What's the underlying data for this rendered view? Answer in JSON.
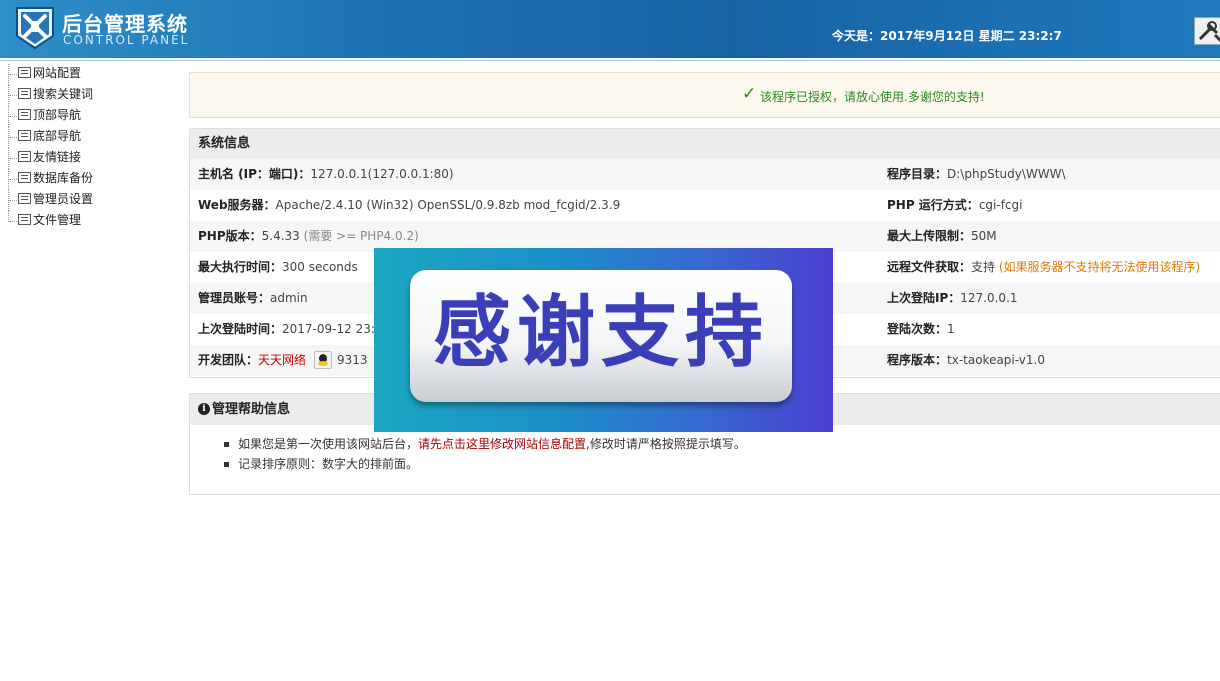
{
  "header": {
    "title": "后台管理系统",
    "subtitle": "CONTROL PANEL",
    "today": "今天是：2017年9月12日 星期二 23:2:7",
    "tools_icon": "tools-icon"
  },
  "sidebar": {
    "items": [
      {
        "label": "网站配置"
      },
      {
        "label": "搜索关键词"
      },
      {
        "label": "顶部导航"
      },
      {
        "label": "底部导航"
      },
      {
        "label": "友情链接"
      },
      {
        "label": "数据库备份"
      },
      {
        "label": "管理员设置"
      },
      {
        "label": "文件管理"
      }
    ]
  },
  "notice": {
    "text": "该程序已授权，请放心使用.多谢您的支持!",
    "icon": "check-icon",
    "color": "#2a8a1f"
  },
  "system_info": {
    "title": "系统信息",
    "rows": [
      {
        "l_label": "主机名 (IP：端口)：",
        "l_value": "127.0.0.1(127.0.0.1:80)",
        "r_label": "程序目录：",
        "r_value": "D:\\phpStudy\\WWW\\"
      },
      {
        "l_label": "Web服务器：",
        "l_value": "Apache/2.4.10 (Win32) OpenSSL/0.9.8zb mod_fcgid/2.3.9",
        "r_label": "PHP 运行方式：",
        "r_value": "cgi-fcgi"
      },
      {
        "l_label": "PHP版本：",
        "l_value": "5.4.33",
        "l_note": "(需要 >= PHP4.0.2)",
        "r_label": "最大上传限制：",
        "r_value": "50M"
      },
      {
        "l_label": "最大执行时间：",
        "l_value": "300 seconds",
        "r_label": "远程文件获取：",
        "r_value": "支持",
        "r_note": "(如果服务器不支持将无法使用该程序)"
      },
      {
        "l_label": "管理员账号：",
        "l_value": "admin",
        "r_label": "上次登陆IP：",
        "r_value": "127.0.0.1"
      },
      {
        "l_label": "上次登陆时间：",
        "l_value": "2017-09-12 23:0",
        "r_label": "登陆次数：",
        "r_value": "1"
      },
      {
        "l_label": "开发团队：",
        "l_value": "天天网络",
        "l_qq": "9313",
        "r_label": "程序版本：",
        "r_value": "tx-taokeapi-v1.0"
      }
    ]
  },
  "help": {
    "title": "管理帮助信息",
    "item1_prefix": "如果您是第一次使用该网站后台，",
    "item1_link": "请先点击这里修改网站信息配置",
    "item1_suffix": ",修改时请严格按照提示填写。",
    "item2": "记录排序原则：数字大的排前面。"
  },
  "banner": {
    "text": "感谢支持"
  },
  "colors": {
    "header_blue": "#1763a6",
    "accent_red": "#c00",
    "note_orange": "#e07a0a"
  }
}
